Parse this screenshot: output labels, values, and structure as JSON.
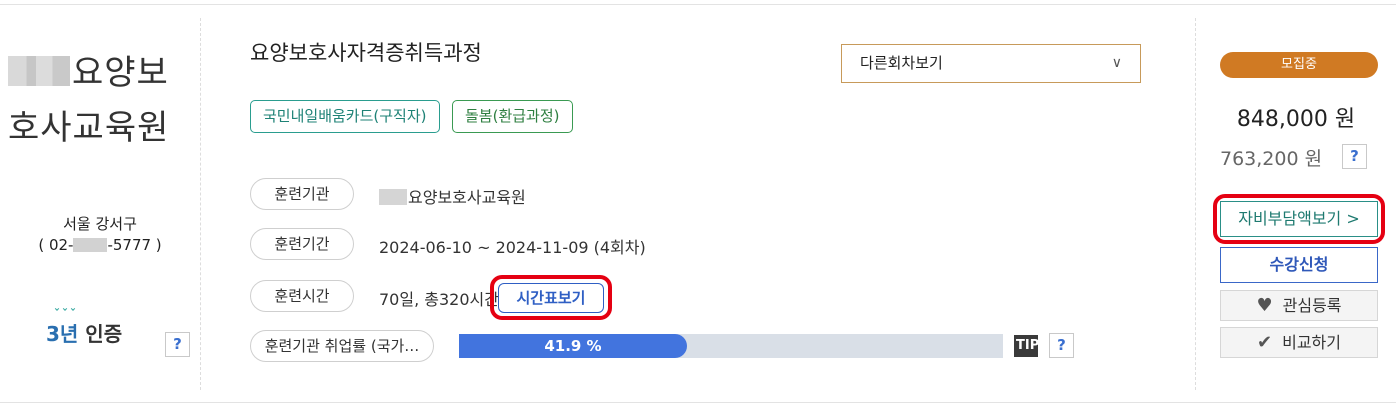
{
  "org": {
    "name_visible": "요양보호사교육원",
    "name_line1": "요양보",
    "name_line2": "호사교육원",
    "region": "서울 강서구",
    "phone_prefix": "( 02-",
    "phone_suffix": "-5777 )",
    "cert_label": "3년 인증",
    "cert_num": "3년",
    "cert_text": "인증",
    "help_label": "?"
  },
  "course": {
    "title": "요양보호사자격증취득과정",
    "round_select": {
      "selected": "다른회차보기",
      "chevron": "∨"
    },
    "tags": [
      "국민내일배움카드(구직자)",
      "돌봄(환급과정)"
    ]
  },
  "details": [
    {
      "label": "훈련기관",
      "value": "요양보호사교육원"
    },
    {
      "label": "훈련기간",
      "value": "2024-06-10 ~ 2024-11-09 (4회차)"
    },
    {
      "label": "훈련시간",
      "value": "70일, 총320시간"
    }
  ],
  "timetable_button": "시간표보기",
  "employment": {
    "label": "훈련기관 취업률 (국가…",
    "rate_text": "41.9 %",
    "rate_value": 41.9,
    "tip_label": "TIP",
    "help_label": "?"
  },
  "side": {
    "status_badge": "모집중",
    "price_main": "848,000 원",
    "price_sub": "763,200 원",
    "help_label": "?",
    "self_pay_button": "자비부담액보기 >",
    "apply_button": "수강신청",
    "favorite_button": "관심등록",
    "compare_button": "비교하기",
    "favorite_icon": "heart-icon",
    "compare_icon": "check-icon"
  },
  "colors": {
    "accent_orange": "#d07a23",
    "bar_fill": "#4274de",
    "highlight_red": "#e50012",
    "teal": "#2a9d8f"
  }
}
